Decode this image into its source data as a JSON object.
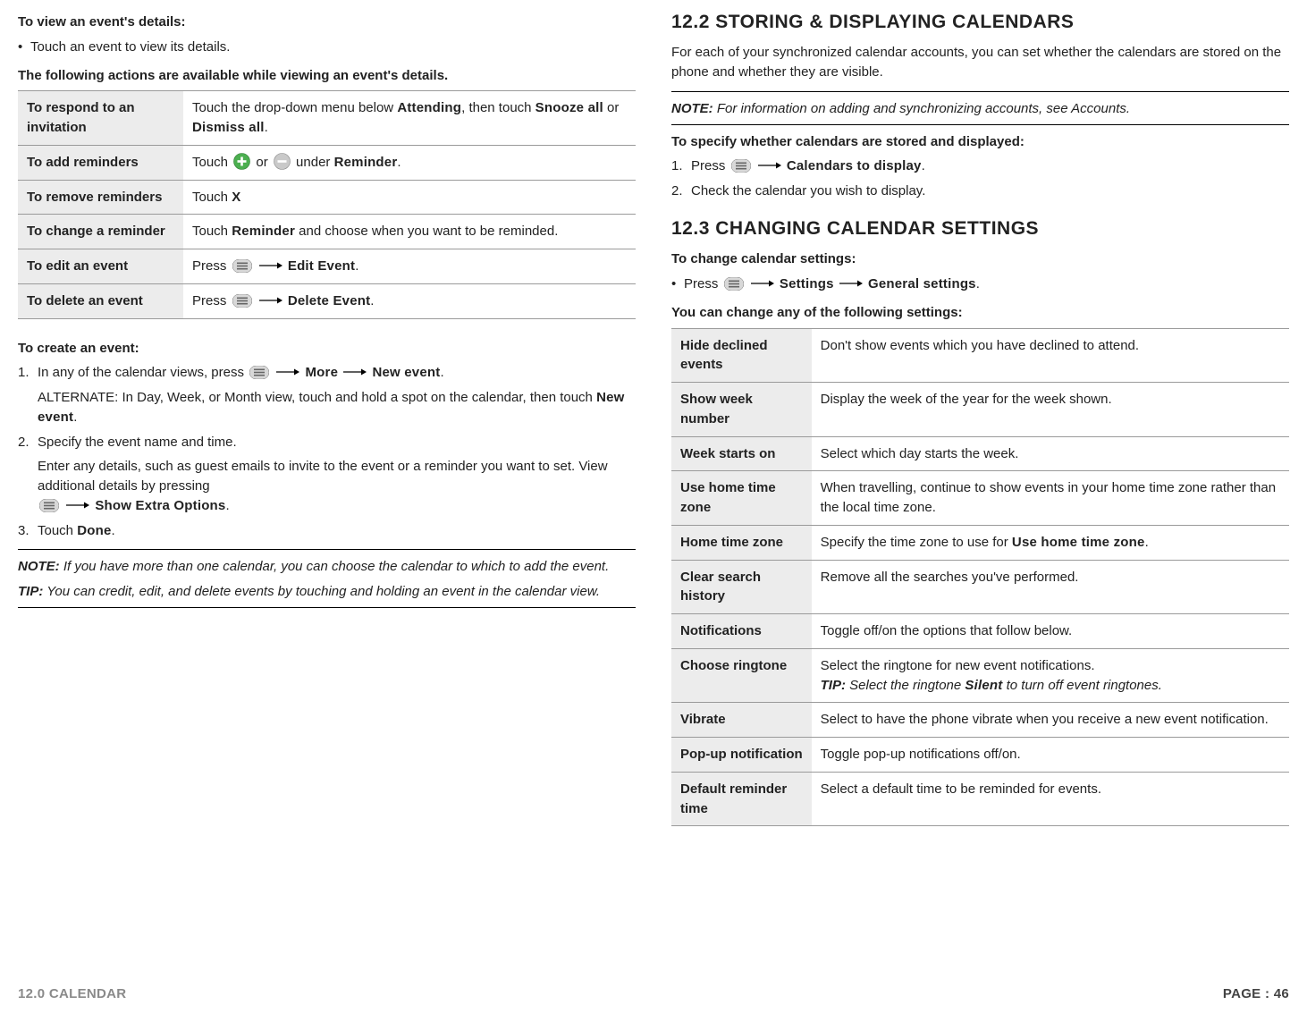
{
  "left": {
    "h_view": "To view an event's details:",
    "b_view": "Touch an event to view its details.",
    "h_actions": "The following actions are available while viewing an event's details.",
    "table1": [
      {
        "label": "To respond to an invitation",
        "val_pre": "Touch the drop-down menu below ",
        "val_b1": "Attending",
        "val_mid": ", then touch ",
        "val_b2": "Snooze all",
        "val_or": " or ",
        "val_b3": "Dismiss all",
        "val_post": "."
      },
      {
        "label": "To add reminders",
        "val_pre": "Touch ",
        "val_mid": " or ",
        "val_post2": " under ",
        "val_b1": "Reminder",
        "val_end": "."
      },
      {
        "label": "To remove reminders",
        "val_pre": "Touch ",
        "val_b1": "X"
      },
      {
        "label": "To change a reminder",
        "val_pre": "Touch ",
        "val_b1": "Reminder",
        "val_post": " and choose when you want to be reminded."
      },
      {
        "label": "To edit an event",
        "val_pre": "Press ",
        "val_b1": "Edit Event",
        "val_end": "."
      },
      {
        "label": "To delete an event",
        "val_pre": "Press ",
        "val_b1": "Delete Event",
        "val_end": "."
      }
    ],
    "h_create": "To create an event:",
    "step1_pre": "In any of the calendar views, press ",
    "step1_b1": "More",
    "step1_b2": "New event",
    "step1_end": ".",
    "step1_alt_pre": "ALTERNATE: In Day, Week, or Month view, touch and hold a spot on the calendar, then touch ",
    "step1_alt_b": "New event",
    "step1_alt_end": ".",
    "step2": "Specify the event name and time.",
    "step2_det_pre": "Enter any details, such as guest emails to invite to the event or a reminder you want to set. View additional details by pressing",
    "step2_det_b": "Show Extra Options",
    "step2_det_end": ".",
    "step3_pre": "Touch ",
    "step3_b": "Done",
    "step3_end": ".",
    "note1_lbl": "NOTE:",
    "note1_txt": " If you have more than one calendar, you can choose the calendar to which to add the event.",
    "tip1_lbl": "TIP:",
    "tip1_txt": " You can credit, edit, and delete events by touching and holding an event in the calendar view."
  },
  "right": {
    "sec122": "12.2 STORING & DISPLAYING CALENDARS",
    "p122": "For each of your synchronized calendar accounts, you can set whether the calendars are stored on the phone and whether they are visible.",
    "note2_lbl": "NOTE:",
    "note2_txt": " For information on adding and synchronizing accounts, see Accounts.",
    "h_spec": "To specify whether calendars are stored and displayed:",
    "spec1_pre": "Press ",
    "spec1_b": "Calendars to display",
    "spec1_end": ".",
    "spec2": "Check the calendar you wish to display.",
    "sec123": "12.3 CHANGING CALENDAR SETTINGS",
    "h_change": "To change calendar settings:",
    "chg_pre": "Press ",
    "chg_b1": "Settings",
    "chg_b2": "General settings",
    "chg_end": ".",
    "h_settings": "You can change any of the following settings:",
    "table2": [
      {
        "label": "Hide declined events",
        "val": "Don't show events which you have declined to attend."
      },
      {
        "label": "Show week number",
        "val": "Display the week of the year for the week shown."
      },
      {
        "label": "Week starts on",
        "val": "Select which day starts the week."
      },
      {
        "label": "Use home time zone",
        "val": "When travelling, continue to show events in your home time zone rather than the local time zone."
      },
      {
        "label": "Home time zone",
        "val_pre": "Specify the time zone to use for ",
        "val_b": "Use home time zone",
        "val_end": "."
      },
      {
        "label": "Clear search history",
        "val": "Remove all the searches you've performed."
      },
      {
        "label": "Notifications",
        "val": "Toggle off/on the options that follow below."
      },
      {
        "label": "Choose ringtone",
        "val": "Select the ringtone for new event notifications.",
        "tip_lbl": "TIP:",
        "tip_pre": " Select the ringtone ",
        "tip_b": "Silent",
        "tip_post": " to turn off event ringtones."
      },
      {
        "label": "Vibrate",
        "val": "Select to have the phone vibrate when you receive a new event notification."
      },
      {
        "label": "Pop-up notification",
        "val": "Toggle pop-up notifications off/on."
      },
      {
        "label": "Default reminder time",
        "val": "Select a default time to be reminded for events."
      }
    ]
  },
  "footer": {
    "left": "12.0 CALENDAR",
    "right": "PAGE : 46"
  }
}
